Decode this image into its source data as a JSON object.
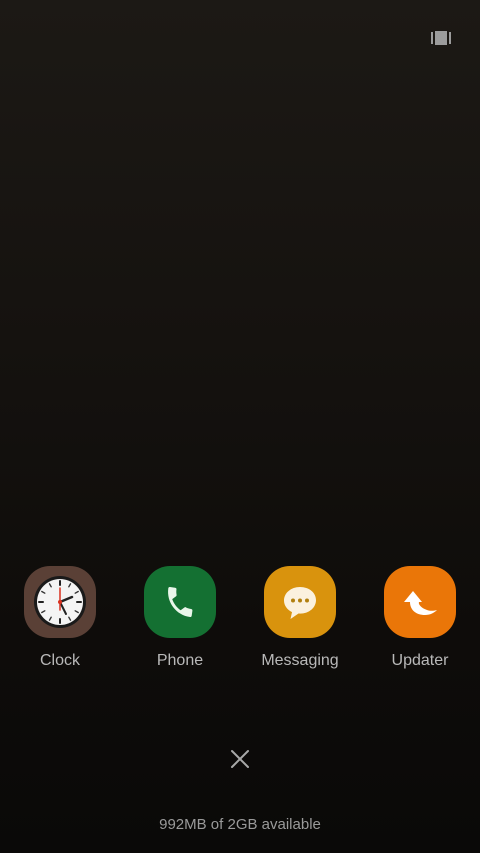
{
  "header": {
    "view_toggle_icon": "card-view-icon"
  },
  "recent_apps": [
    {
      "label": "Clock",
      "icon": "clock-icon",
      "color": "#5a4036"
    },
    {
      "label": "Phone",
      "icon": "phone-icon",
      "color": "#147032"
    },
    {
      "label": "Messaging",
      "icon": "message-bubble-icon",
      "color": "#d9930d"
    },
    {
      "label": "Updater",
      "icon": "updater-arrow-icon",
      "color": "#ea7608"
    }
  ],
  "close_all": {
    "icon": "close-icon"
  },
  "memory": {
    "text": "992MB of 2GB available"
  }
}
